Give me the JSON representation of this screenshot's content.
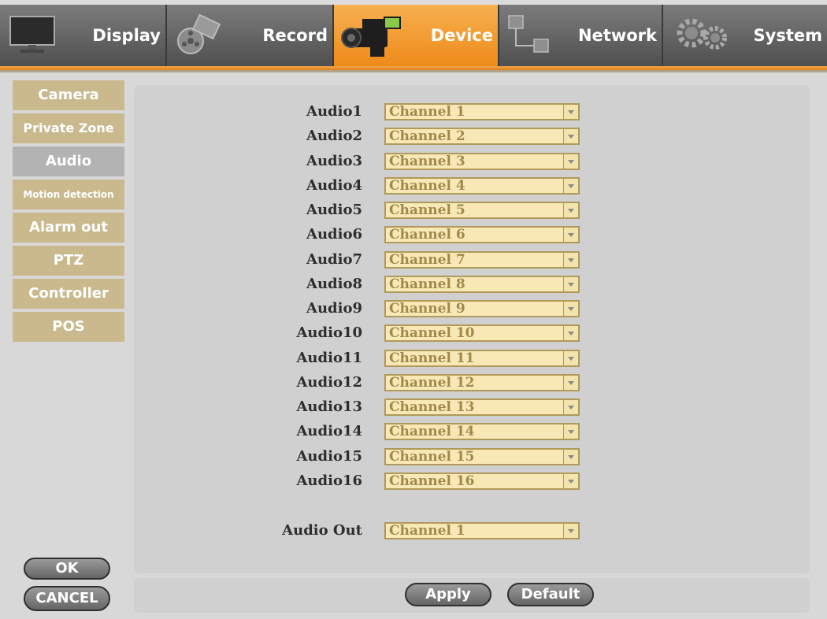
{
  "tabs": [
    {
      "label": "Display",
      "icon": "monitor-icon"
    },
    {
      "label": "Record",
      "icon": "film-reel-icon"
    },
    {
      "label": "Device",
      "icon": "camcorder-icon",
      "active": true
    },
    {
      "label": "Network",
      "icon": "network-icon"
    },
    {
      "label": "System",
      "icon": "gears-icon"
    }
  ],
  "sidebar": {
    "items": [
      {
        "label": "Camera"
      },
      {
        "label": "Private Zone"
      },
      {
        "label": "Audio",
        "active": true
      },
      {
        "label": "Motion detection"
      },
      {
        "label": "Alarm out"
      },
      {
        "label": "PTZ"
      },
      {
        "label": "Controller"
      },
      {
        "label": "POS"
      }
    ],
    "ok_label": "OK",
    "cancel_label": "CANCEL"
  },
  "audio": {
    "channels": [
      {
        "label": "Audio1",
        "value": "Channel 1"
      },
      {
        "label": "Audio2",
        "value": "Channel 2"
      },
      {
        "label": "Audio3",
        "value": "Channel 3"
      },
      {
        "label": "Audio4",
        "value": "Channel 4"
      },
      {
        "label": "Audio5",
        "value": "Channel 5"
      },
      {
        "label": "Audio6",
        "value": "Channel 6"
      },
      {
        "label": "Audio7",
        "value": "Channel 7"
      },
      {
        "label": "Audio8",
        "value": "Channel 8"
      },
      {
        "label": "Audio9",
        "value": "Channel 9"
      },
      {
        "label": "Audio10",
        "value": "Channel 10"
      },
      {
        "label": "Audio11",
        "value": "Channel 11"
      },
      {
        "label": "Audio12",
        "value": "Channel 12"
      },
      {
        "label": "Audio13",
        "value": "Channel 13"
      },
      {
        "label": "Audio14",
        "value": "Channel 14"
      },
      {
        "label": "Audio15",
        "value": "Channel 15"
      },
      {
        "label": "Audio16",
        "value": "Channel 16"
      }
    ],
    "audio_out": {
      "label": "Audio Out",
      "value": "Channel 1"
    }
  },
  "buttons": {
    "apply_label": "Apply",
    "default_label": "Default"
  },
  "colors": {
    "active_tab": "#ee8a1b",
    "sidebar_item": "#c9b98d",
    "sidebar_active": "#b3b3b3",
    "select_bg": "#f8e8b6",
    "select_text": "#a08a4b"
  }
}
